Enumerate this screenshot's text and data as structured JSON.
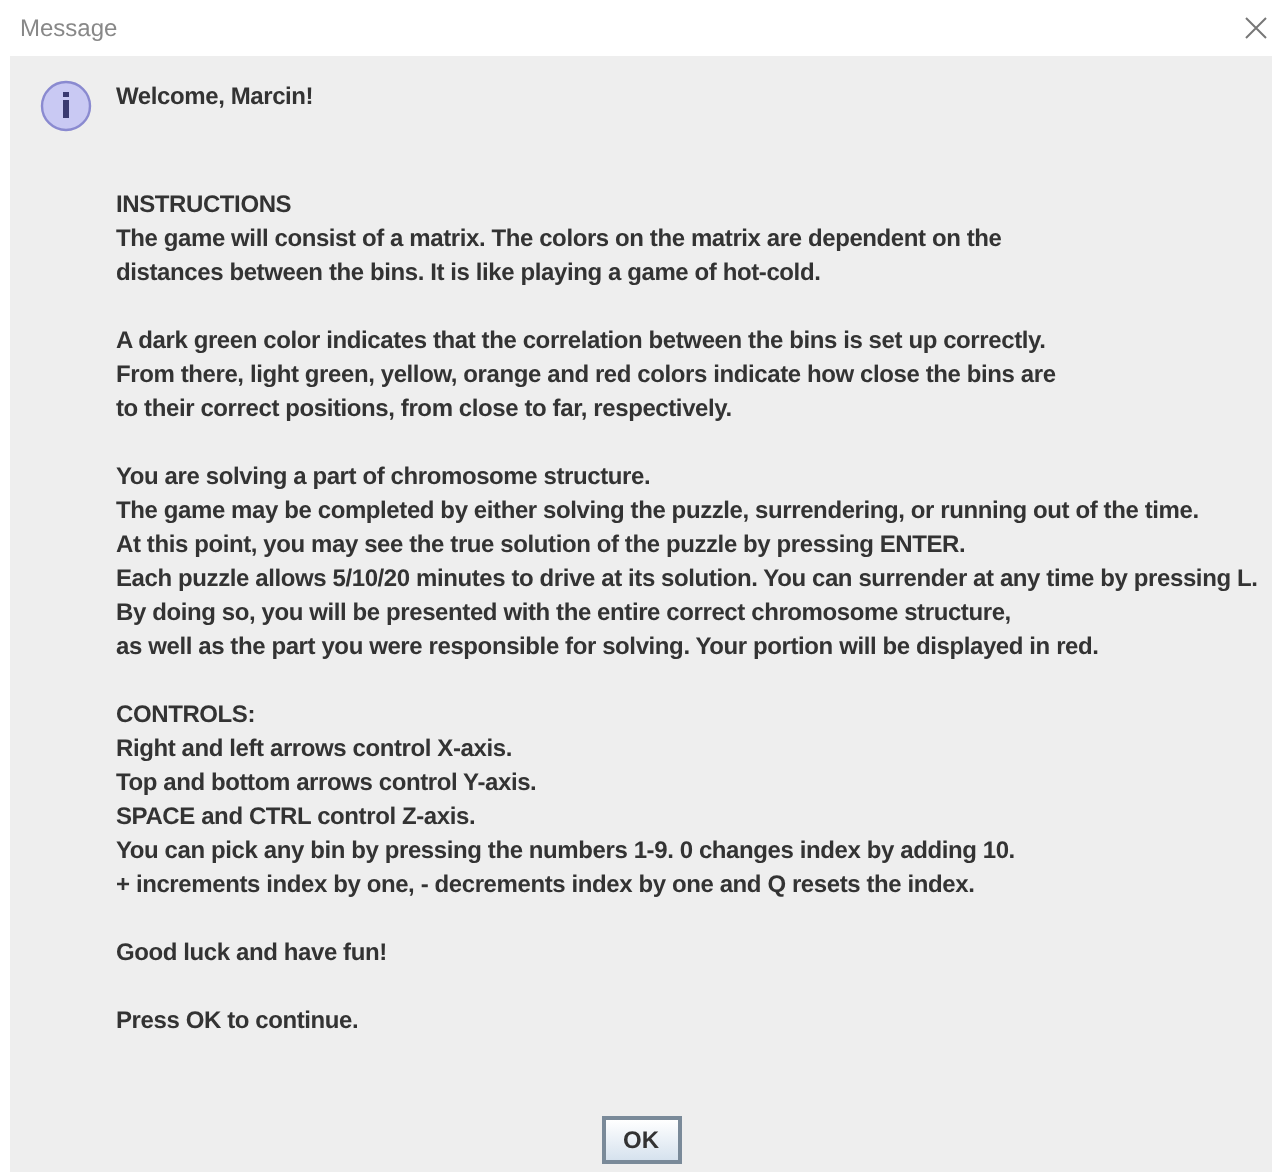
{
  "window": {
    "title": "Message"
  },
  "greeting": "Welcome, Marcin!",
  "paragraphs": [
    [
      "INSTRUCTIONS",
      "The game will consist of a matrix. The colors on the matrix are dependent on the",
      "distances between the bins. It is like playing a game of hot-cold."
    ],
    [
      "A dark green color indicates that the correlation between the bins is set up correctly.",
      "From there, light green, yellow, orange and red colors indicate how close the bins are",
      "to their correct positions, from close to far, respectively."
    ],
    [
      "You are solving a part of chromosome structure.",
      "The game may be completed by either solving the puzzle, surrendering, or running out of the time.",
      "At this point, you may see the true solution of the puzzle by pressing ENTER.",
      "Each puzzle allows 5/10/20 minutes to drive at its solution. You can surrender at any time by pressing L.",
      "By doing so, you will be presented with the entire correct chromosome structure,",
      "as well as the part you were responsible for solving. Your portion will be displayed in red."
    ],
    [
      "CONTROLS:",
      "Right and left arrows control X-axis.",
      "Top and bottom arrows control Y-axis.",
      "SPACE and CTRL control Z-axis.",
      "You can pick any bin by pressing the numbers 1-9. 0 changes index by adding 10.",
      "+ increments index by one, - decrements index by one and Q resets the index."
    ],
    [
      "Good luck and have fun!"
    ],
    [
      "Press OK to continue."
    ]
  ],
  "buttons": [
    "OK"
  ]
}
